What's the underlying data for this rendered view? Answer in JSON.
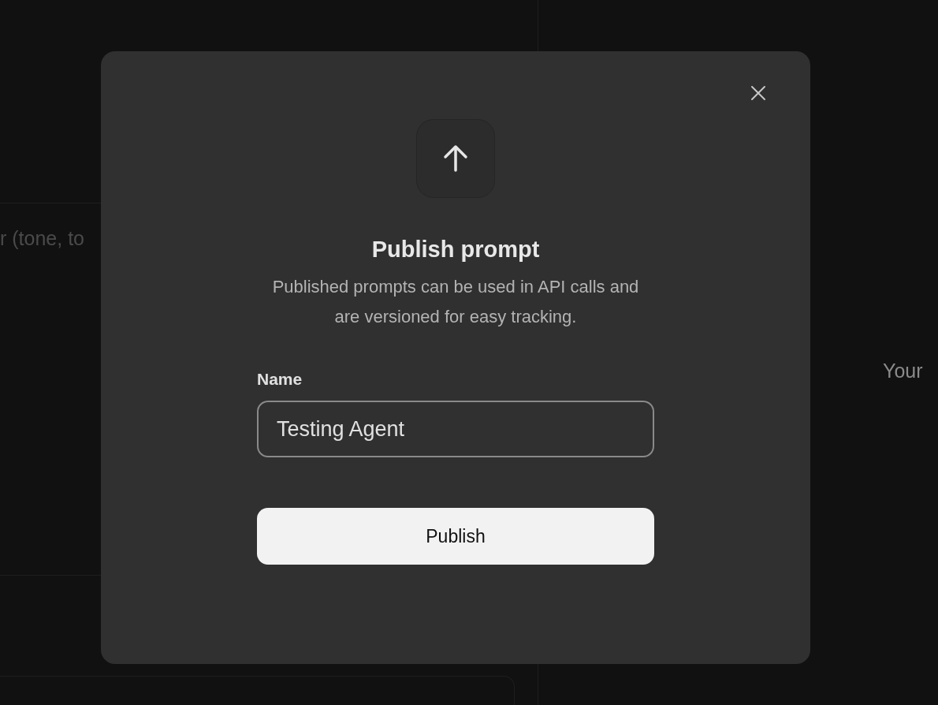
{
  "background": {
    "editor_placeholder": "r (tone, to",
    "output_placeholder": "Your"
  },
  "dialog": {
    "title": "Publish prompt",
    "description": "Published prompts can be used in API calls and are versioned for easy tracking.",
    "field": {
      "label": "Name",
      "value": "Testing Agent"
    },
    "button": "Publish"
  }
}
